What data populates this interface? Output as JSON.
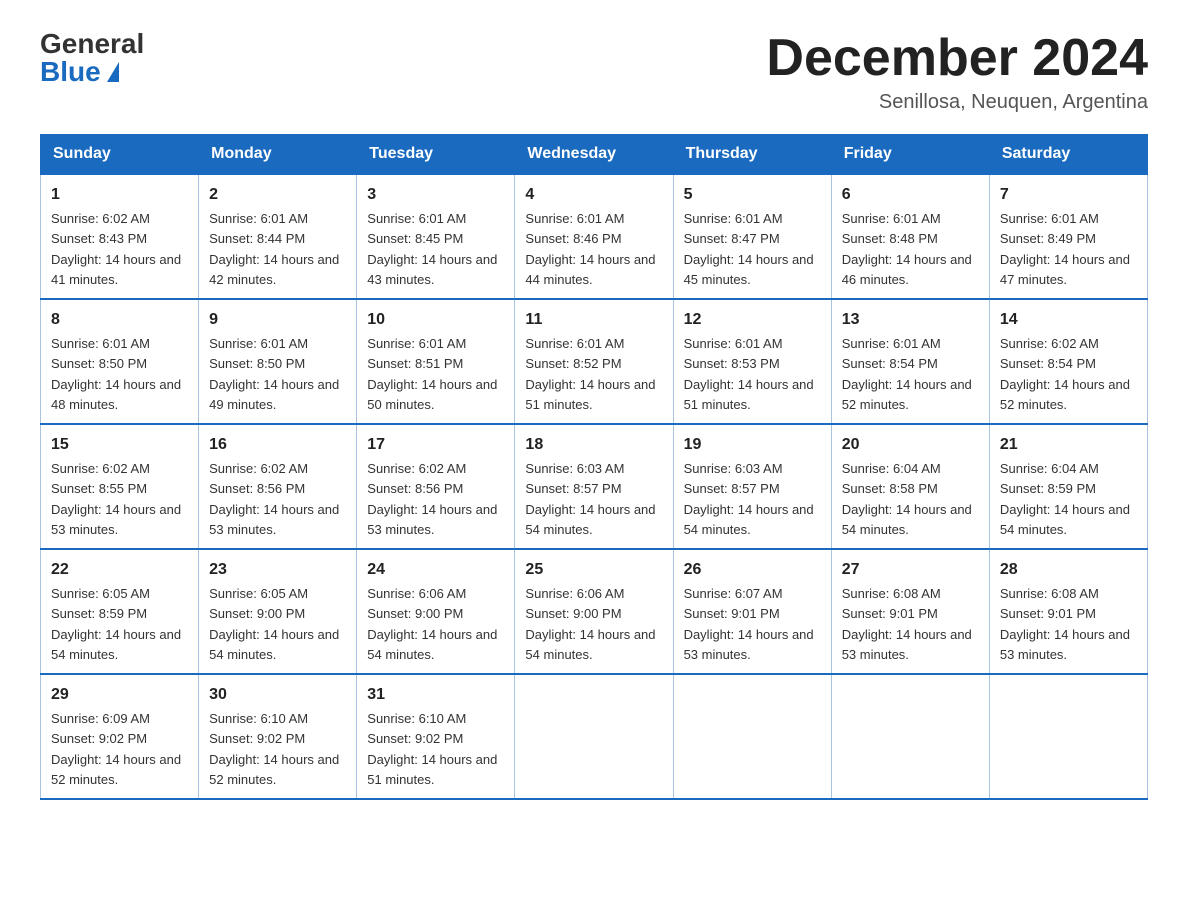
{
  "header": {
    "logo_general": "General",
    "logo_blue": "Blue",
    "month_title": "December 2024",
    "subtitle": "Senillosa, Neuquen, Argentina"
  },
  "columns": [
    "Sunday",
    "Monday",
    "Tuesday",
    "Wednesday",
    "Thursday",
    "Friday",
    "Saturday"
  ],
  "weeks": [
    [
      {
        "day": "1",
        "sunrise": "6:02 AM",
        "sunset": "8:43 PM",
        "daylight": "14 hours and 41 minutes."
      },
      {
        "day": "2",
        "sunrise": "6:01 AM",
        "sunset": "8:44 PM",
        "daylight": "14 hours and 42 minutes."
      },
      {
        "day": "3",
        "sunrise": "6:01 AM",
        "sunset": "8:45 PM",
        "daylight": "14 hours and 43 minutes."
      },
      {
        "day": "4",
        "sunrise": "6:01 AM",
        "sunset": "8:46 PM",
        "daylight": "14 hours and 44 minutes."
      },
      {
        "day": "5",
        "sunrise": "6:01 AM",
        "sunset": "8:47 PM",
        "daylight": "14 hours and 45 minutes."
      },
      {
        "day": "6",
        "sunrise": "6:01 AM",
        "sunset": "8:48 PM",
        "daylight": "14 hours and 46 minutes."
      },
      {
        "day": "7",
        "sunrise": "6:01 AM",
        "sunset": "8:49 PM",
        "daylight": "14 hours and 47 minutes."
      }
    ],
    [
      {
        "day": "8",
        "sunrise": "6:01 AM",
        "sunset": "8:50 PM",
        "daylight": "14 hours and 48 minutes."
      },
      {
        "day": "9",
        "sunrise": "6:01 AM",
        "sunset": "8:50 PM",
        "daylight": "14 hours and 49 minutes."
      },
      {
        "day": "10",
        "sunrise": "6:01 AM",
        "sunset": "8:51 PM",
        "daylight": "14 hours and 50 minutes."
      },
      {
        "day": "11",
        "sunrise": "6:01 AM",
        "sunset": "8:52 PM",
        "daylight": "14 hours and 51 minutes."
      },
      {
        "day": "12",
        "sunrise": "6:01 AM",
        "sunset": "8:53 PM",
        "daylight": "14 hours and 51 minutes."
      },
      {
        "day": "13",
        "sunrise": "6:01 AM",
        "sunset": "8:54 PM",
        "daylight": "14 hours and 52 minutes."
      },
      {
        "day": "14",
        "sunrise": "6:02 AM",
        "sunset": "8:54 PM",
        "daylight": "14 hours and 52 minutes."
      }
    ],
    [
      {
        "day": "15",
        "sunrise": "6:02 AM",
        "sunset": "8:55 PM",
        "daylight": "14 hours and 53 minutes."
      },
      {
        "day": "16",
        "sunrise": "6:02 AM",
        "sunset": "8:56 PM",
        "daylight": "14 hours and 53 minutes."
      },
      {
        "day": "17",
        "sunrise": "6:02 AM",
        "sunset": "8:56 PM",
        "daylight": "14 hours and 53 minutes."
      },
      {
        "day": "18",
        "sunrise": "6:03 AM",
        "sunset": "8:57 PM",
        "daylight": "14 hours and 54 minutes."
      },
      {
        "day": "19",
        "sunrise": "6:03 AM",
        "sunset": "8:57 PM",
        "daylight": "14 hours and 54 minutes."
      },
      {
        "day": "20",
        "sunrise": "6:04 AM",
        "sunset": "8:58 PM",
        "daylight": "14 hours and 54 minutes."
      },
      {
        "day": "21",
        "sunrise": "6:04 AM",
        "sunset": "8:59 PM",
        "daylight": "14 hours and 54 minutes."
      }
    ],
    [
      {
        "day": "22",
        "sunrise": "6:05 AM",
        "sunset": "8:59 PM",
        "daylight": "14 hours and 54 minutes."
      },
      {
        "day": "23",
        "sunrise": "6:05 AM",
        "sunset": "9:00 PM",
        "daylight": "14 hours and 54 minutes."
      },
      {
        "day": "24",
        "sunrise": "6:06 AM",
        "sunset": "9:00 PM",
        "daylight": "14 hours and 54 minutes."
      },
      {
        "day": "25",
        "sunrise": "6:06 AM",
        "sunset": "9:00 PM",
        "daylight": "14 hours and 54 minutes."
      },
      {
        "day": "26",
        "sunrise": "6:07 AM",
        "sunset": "9:01 PM",
        "daylight": "14 hours and 53 minutes."
      },
      {
        "day": "27",
        "sunrise": "6:08 AM",
        "sunset": "9:01 PM",
        "daylight": "14 hours and 53 minutes."
      },
      {
        "day": "28",
        "sunrise": "6:08 AM",
        "sunset": "9:01 PM",
        "daylight": "14 hours and 53 minutes."
      }
    ],
    [
      {
        "day": "29",
        "sunrise": "6:09 AM",
        "sunset": "9:02 PM",
        "daylight": "14 hours and 52 minutes."
      },
      {
        "day": "30",
        "sunrise": "6:10 AM",
        "sunset": "9:02 PM",
        "daylight": "14 hours and 52 minutes."
      },
      {
        "day": "31",
        "sunrise": "6:10 AM",
        "sunset": "9:02 PM",
        "daylight": "14 hours and 51 minutes."
      },
      null,
      null,
      null,
      null
    ]
  ]
}
